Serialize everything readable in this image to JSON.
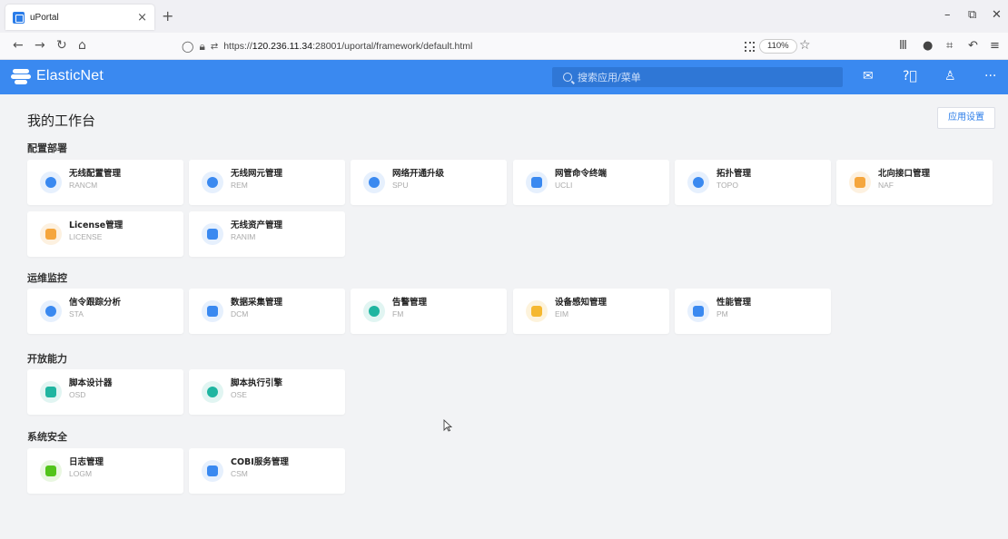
{
  "browser": {
    "tab_title": "uPortal",
    "tab_close": "×",
    "new_tab": "+",
    "url_prefix": "https://",
    "url_host": "120.236.11.34",
    "url_rest": ":28001/uportal/framework/default.html",
    "zoom": "110%"
  },
  "app": {
    "logo_text": "ElasticNet",
    "search_placeholder": "搜索应用/菜单",
    "brand_color": "#3a89f0"
  },
  "main": {
    "page_title": "我的工作台",
    "settings_label": "应用设置"
  },
  "sections": [
    {
      "title": "配置部署",
      "cards": [
        {
          "name": "无线配置管理",
          "code": "RANCM",
          "icon": "gear-icon",
          "color": "#3a89f0",
          "bg": "#e6f0fd"
        },
        {
          "name": "无线网元管理",
          "code": "REM",
          "icon": "network-element-icon",
          "color": "#3a89f0",
          "bg": "#e6f0fd"
        },
        {
          "name": "网络开通升级",
          "code": "SPU",
          "icon": "globe-upgrade-icon",
          "color": "#3a89f0",
          "bg": "#e6f0fd"
        },
        {
          "name": "网管命令终端",
          "code": "UCLI",
          "icon": "terminal-icon",
          "color": "#3a89f0",
          "bg": "#e6f0fd"
        },
        {
          "name": "拓扑管理",
          "code": "TOPO",
          "icon": "topology-icon",
          "color": "#3a89f0",
          "bg": "#e6f0fd"
        },
        {
          "name": "北向接口管理",
          "code": "NAF",
          "icon": "interface-icon",
          "color": "#f5a63d",
          "bg": "#fdf1e0"
        },
        {
          "name": "License管理",
          "code": "LICENSE",
          "icon": "license-icon",
          "color": "#f5a63d",
          "bg": "#fdf1e0"
        },
        {
          "name": "无线资产管理",
          "code": "RANIM",
          "icon": "asset-icon",
          "color": "#3a89f0",
          "bg": "#e6f0fd"
        }
      ]
    },
    {
      "title": "运维监控",
      "cards": [
        {
          "name": "信令跟踪分析",
          "code": "STA",
          "icon": "signal-trace-icon",
          "color": "#3a89f0",
          "bg": "#e6f0fd"
        },
        {
          "name": "数据采集管理",
          "code": "DCM",
          "icon": "database-icon",
          "color": "#3a89f0",
          "bg": "#e6f0fd"
        },
        {
          "name": "告警管理",
          "code": "FM",
          "icon": "bell-icon",
          "color": "#1fb5a0",
          "bg": "#e1f5f2"
        },
        {
          "name": "设备感知管理",
          "code": "EIM",
          "icon": "device-icon",
          "color": "#f5b830",
          "bg": "#fdf3dc"
        },
        {
          "name": "性能管理",
          "code": "PM",
          "icon": "performance-icon",
          "color": "#3a89f0",
          "bg": "#e6f0fd"
        }
      ]
    },
    {
      "title": "开放能力",
      "cards": [
        {
          "name": "脚本设计器",
          "code": "OSD",
          "icon": "script-design-icon",
          "color": "#1fb5a0",
          "bg": "#e1f5f2"
        },
        {
          "name": "脚本执行引擎",
          "code": "OSE",
          "icon": "cloud-engine-icon",
          "color": "#1fb5a0",
          "bg": "#e1f5f2"
        }
      ]
    },
    {
      "title": "系统安全",
      "cards": [
        {
          "name": "日志管理",
          "code": "LOGM",
          "icon": "log-icon",
          "color": "#52c41a",
          "bg": "#e9f7e1"
        },
        {
          "name": "COBI服务管理",
          "code": "CSM",
          "icon": "service-icon",
          "color": "#3a89f0",
          "bg": "#e6f0fd"
        }
      ]
    }
  ]
}
